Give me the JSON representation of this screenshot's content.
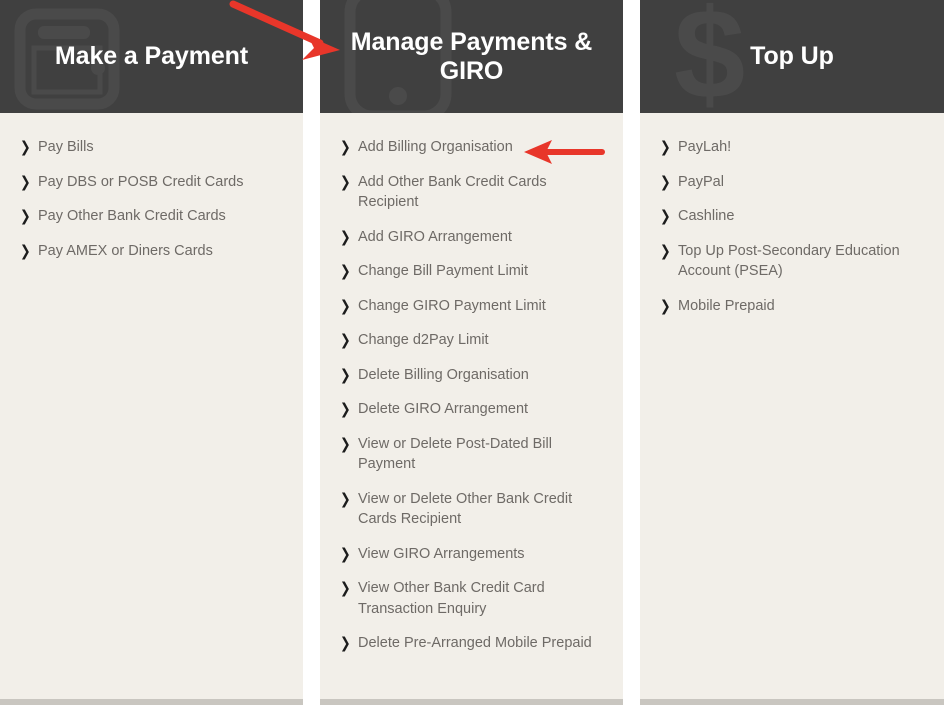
{
  "columns": [
    {
      "id": "make-a-payment",
      "title": "Make a Payment",
      "icon": "wallet-icon",
      "items": [
        {
          "label": "Pay Bills"
        },
        {
          "label": "Pay DBS or POSB Credit Cards"
        },
        {
          "label": "Pay Other Bank Credit Cards"
        },
        {
          "label": "Pay AMEX or Diners Cards"
        }
      ]
    },
    {
      "id": "manage-payments-and-giro",
      "title": "Manage Payments & GIRO",
      "icon": "mobile-phone-icon",
      "items": [
        {
          "label": "Add Billing Organisation"
        },
        {
          "label": "Add Other Bank Credit Cards Recipient"
        },
        {
          "label": "Add GIRO Arrangement"
        },
        {
          "label": "Change Bill Payment Limit"
        },
        {
          "label": "Change GIRO Payment Limit"
        },
        {
          "label": "Change d2Pay Limit"
        },
        {
          "label": "Delete Billing Organisation"
        },
        {
          "label": "Delete GIRO Arrangement"
        },
        {
          "label": "View or Delete Post-Dated Bill Payment"
        },
        {
          "label": "View or Delete Other Bank Credit Cards Recipient"
        },
        {
          "label": "View GIRO Arrangements"
        },
        {
          "label": "View Other Bank Credit Card Transaction Enquiry"
        },
        {
          "label": "Delete Pre-Arranged Mobile Prepaid"
        }
      ]
    },
    {
      "id": "top-up",
      "title": "Top Up",
      "icon": "dollar-sign-icon",
      "items": [
        {
          "label": "PayLah!"
        },
        {
          "label": "PayPal"
        },
        {
          "label": "Cashline"
        },
        {
          "label": "Top Up Post-Secondary Education Account (PSEA)"
        },
        {
          "label": "Mobile Prepaid"
        }
      ]
    }
  ],
  "chevron_glyph": "❯",
  "annotations": [
    {
      "name": "arrow-to-manage-payments-header",
      "direction": "down-right"
    },
    {
      "name": "arrow-to-add-billing-organisation",
      "direction": "left"
    }
  ],
  "colors": {
    "header_bg": "#404040",
    "body_bg": "#f2efe9",
    "title_text": "#ffffff",
    "item_text": "#6e6a66",
    "chevron": "#1c1c1c",
    "annotation_red": "#e8362a",
    "bottom_border": "#c9c6c0",
    "watermark": "#4a4a4a"
  }
}
